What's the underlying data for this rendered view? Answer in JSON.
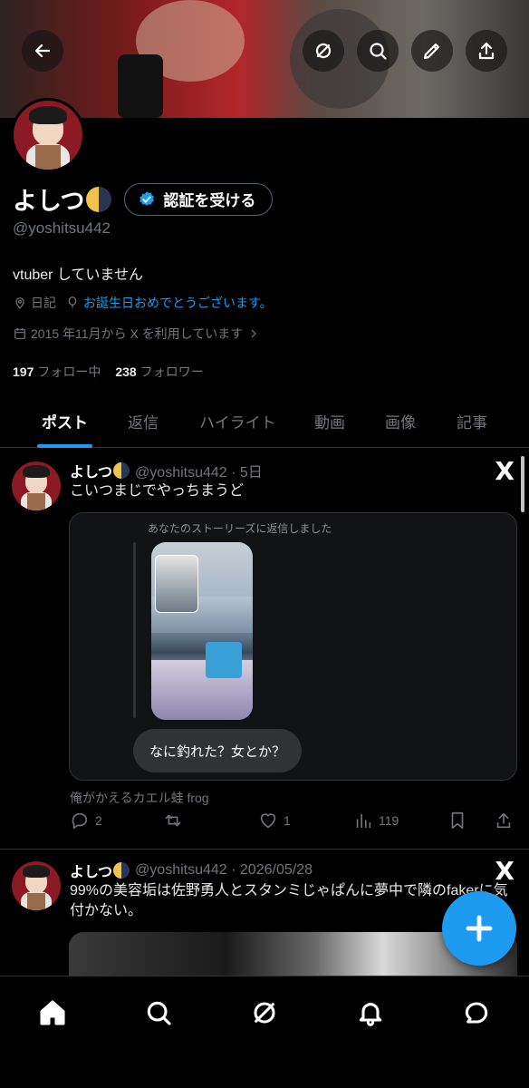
{
  "profile": {
    "name": "よしつ",
    "verify_label": "認証を受ける",
    "handle": "@yoshitsu442",
    "bio": "vtuber していません",
    "location": "日記",
    "birthday_link": "お誕生日おめでとうございます。",
    "joined": "2015 年11月から X を利用しています",
    "following_count": "197",
    "following_label": "フォロー中",
    "followers_count": "238",
    "followers_label": "フォロワー"
  },
  "tabs": [
    {
      "label": "ポスト",
      "active": true
    },
    {
      "label": "返信",
      "active": false
    },
    {
      "label": "ハイライト",
      "active": false
    },
    {
      "label": "動画",
      "active": false
    },
    {
      "label": "画像",
      "active": false
    },
    {
      "label": "記事",
      "active": false
    }
  ],
  "posts": [
    {
      "name": "よしつ",
      "meta": "@yoshitsu442 · 5日",
      "text": "こいつまじでやっちまうど",
      "quote_label": "あなたのストーリーズに返信しました",
      "quote_reply": "なに釣れた？女とか？",
      "source": "俺がかえるカエル蛙 frog",
      "replies": "2",
      "likes": "1",
      "views": "119"
    },
    {
      "name": "よしつ",
      "meta": "@yoshitsu442 · 2026/05/28",
      "text": "99%の美容垢は佐野勇人とスタンミじゃぱんに夢中で隣のfakerに気付かない。"
    }
  ],
  "icons": {
    "back": "arrow-left-icon",
    "grok": "grok-icon",
    "search": "search-icon",
    "edit": "pencil-icon",
    "share": "share-icon",
    "x_logo": "X"
  },
  "colors": {
    "accent": "#1d9bf0",
    "background": "#000000",
    "muted": "#71767b"
  }
}
